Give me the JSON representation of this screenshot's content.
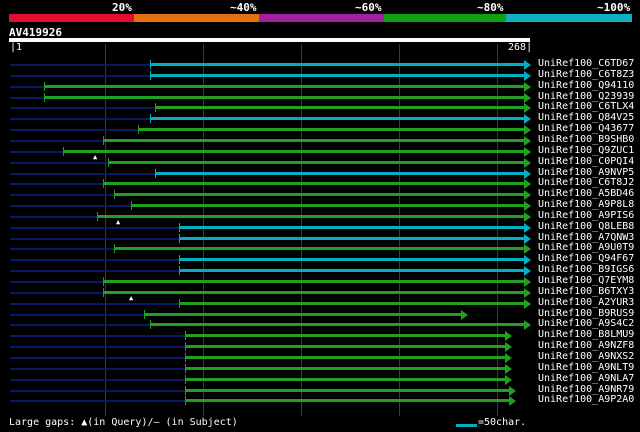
{
  "identity_scale": [
    {
      "label": "20%",
      "color": "#e0102c"
    },
    {
      "label": "~40%",
      "color": "#e07010"
    },
    {
      "label": "~60%",
      "color": "#a020a0"
    },
    {
      "label": "~80%",
      "color": "#10a010"
    },
    {
      "label": "~100%",
      "color": "#10b0c0"
    }
  ],
  "query": {
    "id": "AV419926",
    "start": "1",
    "end": "268"
  },
  "colors": {
    "low": "#0a1a60",
    "high": "#00b0c0",
    "mid": "#20a020"
  },
  "hits": [
    {
      "name": "UniRef100_C6TD67",
      "c": "c",
      "g": [
        [
          150,
          525
        ]
      ],
      "tail": [
        10,
        150
      ]
    },
    {
      "name": "UniRef100_C6T8Z3",
      "c": "c",
      "g": [
        [
          150,
          525
        ]
      ],
      "tail": [
        10,
        150
      ]
    },
    {
      "name": "UniRef100_Q94110",
      "c": "g",
      "g": [
        [
          44,
          525
        ]
      ],
      "tail": [
        10,
        44
      ]
    },
    {
      "name": "UniRef100_Q23939",
      "c": "g",
      "g": [
        [
          44,
          525
        ]
      ],
      "tail": [
        10,
        44
      ]
    },
    {
      "name": "UniRef100_C6TLX4",
      "c": "g",
      "g": [
        [
          155,
          525
        ]
      ],
      "tail": [
        10,
        155
      ]
    },
    {
      "name": "UniRef100_Q84V25",
      "c": "c",
      "g": [
        [
          150,
          525
        ]
      ],
      "tail": [
        10,
        150
      ]
    },
    {
      "name": "UniRef100_Q43677",
      "c": "g",
      "g": [
        [
          138,
          525
        ]
      ],
      "tail": [
        10,
        138
      ]
    },
    {
      "name": "UniRef100_B9SHB0",
      "c": "g",
      "g": [
        [
          103,
          525
        ]
      ],
      "tail": [
        10,
        103
      ]
    },
    {
      "name": "UniRef100_Q9ZUC1",
      "c": "g",
      "g": [
        [
          63,
          525
        ]
      ],
      "tail": [
        10,
        63
      ],
      "mark": 96
    },
    {
      "name": "UniRef100_C0PQI4",
      "c": "g",
      "g": [
        [
          108,
          525
        ]
      ],
      "tail": [
        10,
        108
      ]
    },
    {
      "name": "UniRef100_A9NVP5",
      "c": "c",
      "g": [
        [
          155,
          525
        ]
      ],
      "tail": [
        10,
        155
      ]
    },
    {
      "name": "UniRef100_C6T8J2",
      "c": "g",
      "g": [
        [
          103,
          525
        ]
      ],
      "tail": [
        10,
        103
      ]
    },
    {
      "name": "UniRef100_A5BD46",
      "c": "g",
      "g": [
        [
          114,
          525
        ]
      ],
      "tail": [
        10,
        114
      ]
    },
    {
      "name": "UniRef100_A9P8L8",
      "c": "g",
      "g": [
        [
          131,
          525
        ]
      ],
      "tail": [
        10,
        131
      ]
    },
    {
      "name": "UniRef100_A9PIS6",
      "c": "g",
      "g": [
        [
          97,
          525
        ]
      ],
      "tail": [
        10,
        97
      ],
      "mark": 119
    },
    {
      "name": "UniRef100_Q8LEB8",
      "c": "c",
      "g": [
        [
          179,
          525
        ]
      ],
      "tail": [
        10,
        179
      ]
    },
    {
      "name": "UniRef100_A7QNW3",
      "c": "c",
      "g": [
        [
          179,
          525
        ]
      ],
      "tail": [
        10,
        179
      ]
    },
    {
      "name": "UniRef100_A9U0T9",
      "c": "g",
      "g": [
        [
          114,
          525
        ]
      ],
      "tail": [
        10,
        114
      ]
    },
    {
      "name": "UniRef100_Q94F67",
      "c": "c",
      "g": [
        [
          179,
          525
        ]
      ],
      "tail": [
        10,
        179
      ]
    },
    {
      "name": "UniRef100_B9IGS6",
      "c": "c",
      "g": [
        [
          179,
          525
        ]
      ],
      "tail": [
        10,
        179
      ]
    },
    {
      "name": "UniRef100_Q7EYM8",
      "c": "g",
      "g": [
        [
          103,
          525
        ]
      ],
      "tail": [
        10,
        103
      ]
    },
    {
      "name": "UniRef100_B6TXY3",
      "c": "g",
      "g": [
        [
          103,
          525
        ]
      ],
      "tail": [
        10,
        103
      ],
      "mark": 132
    },
    {
      "name": "UniRef100_A2YUR3",
      "c": "g",
      "g": [
        [
          179,
          525
        ]
      ],
      "tail": [
        10,
        179
      ]
    },
    {
      "name": "UniRef100_B9RUS9",
      "c": "g",
      "g": [
        [
          144,
          462
        ]
      ],
      "tail": [
        10,
        144
      ]
    },
    {
      "name": "UniRef100_A9S4C2",
      "c": "g",
      "g": [
        [
          150,
          525
        ]
      ],
      "tail": [
        10,
        150
      ]
    },
    {
      "name": "UniRef100_B8LMU9",
      "c": "g",
      "g": [
        [
          185,
          506
        ]
      ],
      "tail": [
        10,
        185
      ]
    },
    {
      "name": "UniRef100_A9NZF8",
      "c": "g",
      "g": [
        [
          185,
          506
        ]
      ],
      "tail": [
        10,
        185
      ]
    },
    {
      "name": "UniRef100_A9NXS2",
      "c": "g",
      "g": [
        [
          185,
          506
        ]
      ],
      "tail": [
        10,
        185
      ]
    },
    {
      "name": "UniRef100_A9NLT9",
      "c": "g",
      "g": [
        [
          185,
          506
        ]
      ],
      "tail": [
        10,
        185
      ]
    },
    {
      "name": "UniRef100_A9NLA7",
      "c": "g",
      "g": [
        [
          185,
          506
        ]
      ],
      "tail": [
        10,
        185
      ]
    },
    {
      "name": "UniRef100_A9NR79",
      "c": "g",
      "g": [
        [
          185,
          510
        ]
      ],
      "tail": [
        10,
        185
      ]
    },
    {
      "name": "UniRef100_A9P2A0",
      "c": "g",
      "g": [
        [
          185,
          510
        ]
      ],
      "tail": [
        10,
        185
      ]
    }
  ],
  "footer": {
    "gaps_text": "Large gaps: ▲(in Query)/– (in Subject)",
    "legend_text": "=50char."
  }
}
